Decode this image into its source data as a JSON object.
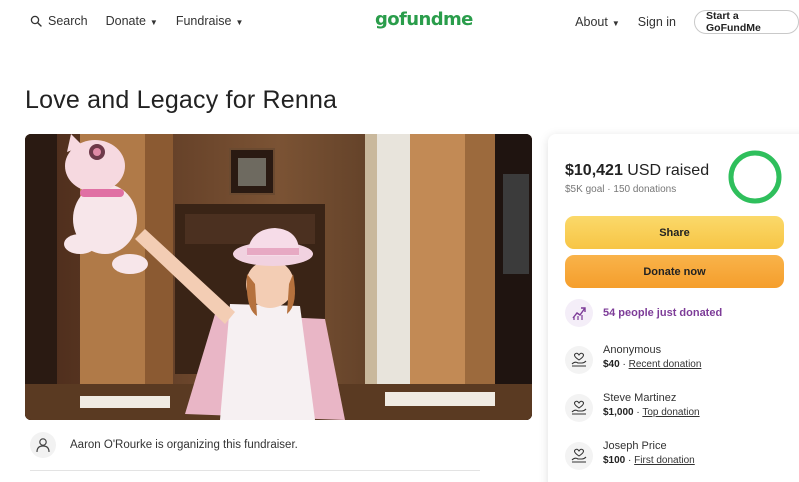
{
  "header": {
    "search_label": "Search",
    "donate_label": "Donate",
    "fundraise_label": "Fundraise",
    "logo_text": "gofundme",
    "about_label": "About",
    "signin_label": "Sign in",
    "start_label": "Start a GoFundMe"
  },
  "campaign": {
    "title": "Love and Legacy for Renna",
    "organizer_text": "Aaron O'Rourke is organizing this fundraiser."
  },
  "stats": {
    "raised_amount": "$10,421",
    "raised_suffix": "USD raised",
    "goal_text": "$5K goal",
    "separator": "·",
    "donations_text": "150 donations",
    "progress_fraction": 1.0
  },
  "actions": {
    "share_label": "Share",
    "donate_label": "Donate now"
  },
  "activity": {
    "just_donated": "54 people just donated"
  },
  "donations": [
    {
      "name": "Anonymous",
      "amount": "$40",
      "sep": "·",
      "tag": "Recent donation"
    },
    {
      "name": "Steve Martinez",
      "amount": "$1,000",
      "sep": "·",
      "tag": "Top donation"
    },
    {
      "name": "Joseph Price",
      "amount": "$100",
      "sep": "·",
      "tag": "First donation"
    }
  ],
  "colors": {
    "brand_green": "#2a9d4b",
    "share_yellow": "#f7c545",
    "donate_orange": "#f59e2c",
    "activity_purple": "#7d3c98"
  }
}
